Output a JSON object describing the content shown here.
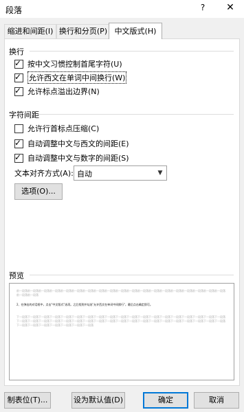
{
  "dialog": {
    "title": "段落",
    "help_glyph": "?",
    "close_glyph": "✕"
  },
  "tabs": [
    {
      "label": "缩进和间距(I)"
    },
    {
      "label": "换行和分页(P)"
    },
    {
      "label": "中文版式(H)"
    }
  ],
  "line_break": {
    "title": "换行",
    "options": [
      {
        "label": "按中文习惯控制首尾字符(U)",
        "checked": true
      },
      {
        "label": "允许西文在单词中间换行(W)",
        "checked": true
      },
      {
        "label": "允许标点溢出边界(N)",
        "checked": true
      }
    ]
  },
  "char_spacing": {
    "title": "字符间距",
    "options": [
      {
        "label": "允许行首标点压缩(C)",
        "checked": false
      },
      {
        "label": "自动调整中文与西文的间距(E)",
        "checked": true
      },
      {
        "label": "自动调整中文与数字的间距(S)",
        "checked": true
      }
    ],
    "align_label": "文本对齐方式(A):",
    "align_value": "自动",
    "options_button": "选项(O)..."
  },
  "preview": {
    "title": "预览",
    "before_text": "前一段落前一段落前一段落前一段落前一段落前一段落前一段落前一段落前一段落前一段落前一段落前一段落前一段落前一段落前一段落前一段落前一段落前一段落前一段落前一段落前一段落",
    "main_text": "2、在弹出的对话框中，点击\"中文版式\"选项。之后找到并勾选\"允许西文在单词中间换行\"，最后点击确定即可。",
    "after_text": "下一段落下一段落下一段落下一段落下一段落下一段落下一段落下一段落下一段落下一段落下一段落下一段落下一段落下一段落下一段落下一段落下一段落下一段落下一段落下一段落下一段落下一段落下一段落下一段落下一段落下一段落下一段落下一段落下一段落下一段落下一段落下一段落下一段落下一段落下一段落下一段落下一段落下一段落下一段落下一段落下一段落下一段落下一段落下一段落下一段落"
  },
  "footer": {
    "tabs_button": "制表位(T)...",
    "default_button": "设为默认值(D)",
    "ok_button": "确定",
    "cancel_button": "取消"
  }
}
